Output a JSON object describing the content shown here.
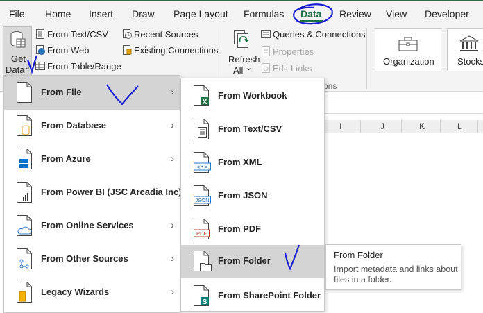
{
  "tabs": [
    "File",
    "Home",
    "Insert",
    "Draw",
    "Page Layout",
    "Formulas",
    "Data",
    "Review",
    "View",
    "Developer"
  ],
  "ribbon": {
    "get_data": [
      "Get",
      "Data"
    ],
    "get_data_caret": "⌄",
    "from_text_csv": "From Text/CSV",
    "from_web": "From Web",
    "from_table_range": "From Table/Range",
    "recent_sources": "Recent Sources",
    "existing_connections": "Existing Connections",
    "refresh": [
      "Refresh",
      "All"
    ],
    "refresh_caret": "⌄",
    "queries_connections": "Queries & Connections",
    "properties": "Properties",
    "edit_links": "Edit Links",
    "group_label_partial": "ons",
    "organization": "Organization",
    "stocks": "Stocks"
  },
  "columns": [
    "I",
    "J",
    "K",
    "L"
  ],
  "menu_primary": {
    "items": [
      {
        "label": "From File",
        "has_submenu": true,
        "highlighted": true,
        "icon": "file-icon"
      },
      {
        "label": "From Database",
        "has_submenu": true,
        "highlighted": false,
        "icon": "database-icon"
      },
      {
        "label": "From Azure",
        "has_submenu": true,
        "highlighted": false,
        "icon": "azure-icon"
      },
      {
        "label": "From Power BI (JSC Arcadia Inc)",
        "has_submenu": false,
        "highlighted": false,
        "icon": "powerbi-icon"
      },
      {
        "label": "From Online Services",
        "has_submenu": true,
        "highlighted": false,
        "icon": "cloud-icon"
      },
      {
        "label": "From Other Sources",
        "has_submenu": true,
        "highlighted": false,
        "icon": "other-sources-icon"
      },
      {
        "label": "Legacy Wizards",
        "has_submenu": true,
        "highlighted": false,
        "icon": "legacy-wizard-icon"
      }
    ],
    "arrow": "›"
  },
  "menu_file": {
    "items": [
      {
        "label": "From Workbook",
        "highlighted": false,
        "icon": "excel-workbook-icon",
        "badge": "X"
      },
      {
        "label": "From Text/CSV",
        "highlighted": false,
        "icon": "text-csv-icon",
        "badge": ""
      },
      {
        "label": "From XML",
        "highlighted": false,
        "icon": "xml-icon",
        "badge": "<•>"
      },
      {
        "label": "From JSON",
        "highlighted": false,
        "icon": "json-icon",
        "badge": "JSON"
      },
      {
        "label": "From PDF",
        "highlighted": false,
        "icon": "pdf-icon",
        "badge": "PDF"
      },
      {
        "label": "From Folder",
        "highlighted": true,
        "icon": "folder-icon",
        "badge": ""
      },
      {
        "label": "From SharePoint Folder",
        "highlighted": false,
        "icon": "sharepoint-icon",
        "badge": "S"
      }
    ]
  },
  "tooltip": {
    "title": "From Folder",
    "body": "Import metadata and links about files in a folder."
  },
  "colors": {
    "accent": "#1e7145",
    "ink": "#1a1fd6",
    "highlight": "#d4d4d4"
  }
}
